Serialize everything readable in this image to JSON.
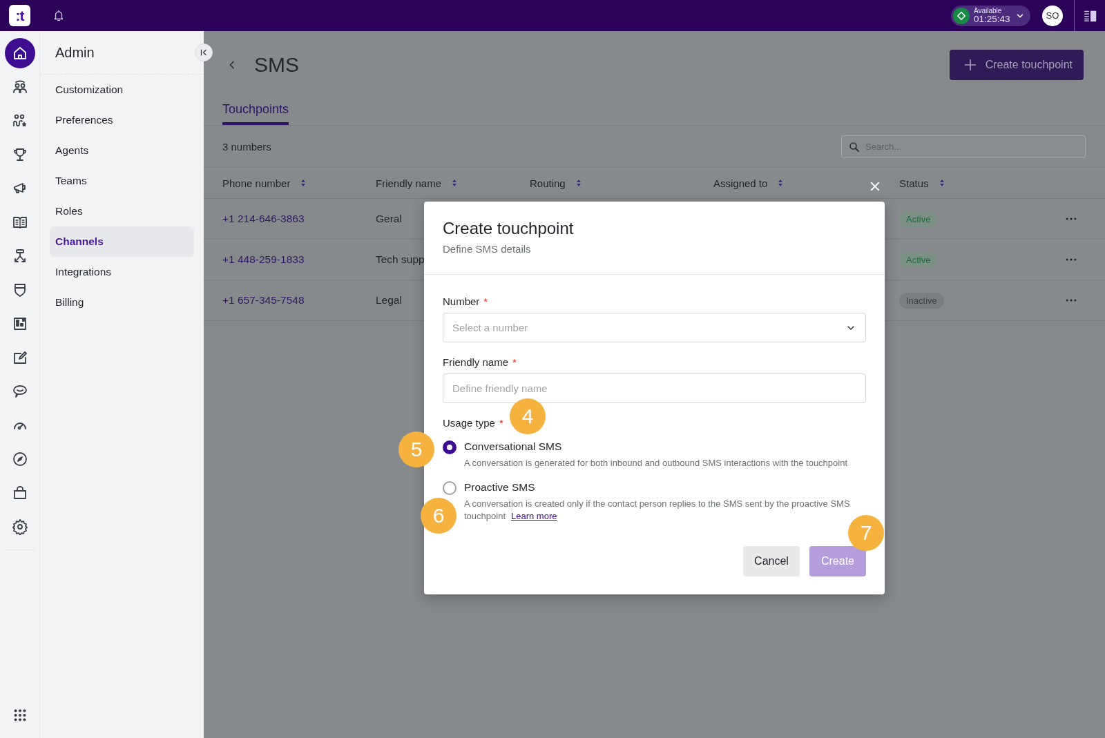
{
  "top_bar": {
    "logo": ":t",
    "status": "Available",
    "timer": "01:25:43",
    "avatar": "SO"
  },
  "rail": [
    {
      "kind": "home",
      "selected": true
    },
    {
      "kind": "people",
      "selected": false
    },
    {
      "kind": "people-star",
      "selected": false
    },
    {
      "kind": "trophy",
      "selected": false
    },
    {
      "kind": "megaphone",
      "selected": false
    },
    {
      "kind": "book",
      "selected": false
    },
    {
      "kind": "flow",
      "selected": false
    },
    {
      "kind": "shield",
      "selected": false
    },
    {
      "kind": "dashboard",
      "selected": false
    },
    {
      "kind": "edit",
      "selected": false
    },
    {
      "kind": "chat",
      "selected": false
    },
    {
      "kind": "gauge",
      "selected": false
    },
    {
      "kind": "compass",
      "selected": false
    },
    {
      "kind": "bag",
      "selected": false
    },
    {
      "kind": "gear",
      "selected": false
    }
  ],
  "admin": {
    "title": "Admin",
    "items": [
      {
        "label": "Customization",
        "selected": false
      },
      {
        "label": "Preferences",
        "selected": false
      },
      {
        "label": "Agents",
        "selected": false
      },
      {
        "label": "Teams",
        "selected": false
      },
      {
        "label": "Roles",
        "selected": false
      },
      {
        "label": "Channels",
        "selected": true
      },
      {
        "label": "Integrations",
        "selected": false
      },
      {
        "label": "Billing",
        "selected": false
      }
    ]
  },
  "page": {
    "title": "SMS",
    "create_button": "Create touchpoint",
    "tabs": [
      {
        "label": "Touchpoints",
        "selected": true
      }
    ],
    "count": "3 numbers",
    "search": {
      "placeholder": "Search..."
    },
    "table": {
      "columns": [
        "Phone number",
        "Friendly name",
        "Routing",
        "Assigned to",
        "Status"
      ],
      "rows": [
        {
          "phone": "+1 214-646-3863",
          "friendly_name": "Geral",
          "status": "Active",
          "active": true
        },
        {
          "phone": "+1 448-259-1833",
          "friendly_name": "Tech supp",
          "status": "Active",
          "active": true
        },
        {
          "phone": "+1 657-345-7548",
          "friendly_name": "Legal",
          "status": "Inactive",
          "active": false
        }
      ]
    }
  },
  "modal": {
    "title": "Create touchpoint",
    "subtitle": "Define SMS details",
    "fields": [
      {
        "kind": "select",
        "label": "Number",
        "required_mark": "*",
        "placeholder": "Select a number"
      },
      {
        "kind": "text",
        "label": "Friendly name",
        "required_mark": "*",
        "placeholder": "Define friendly name"
      }
    ],
    "usage_type": {
      "label": "Usage type",
      "required_mark": "*",
      "options": [
        {
          "label": "Conversational SMS",
          "description": "A conversation is generated for both inbound and outbound SMS interactions with the touchpoint",
          "selected": true
        },
        {
          "label": "Proactive SMS",
          "description": "A conversation is created only if the contact person replies to the SMS sent by the proactive SMS touchpoint",
          "link": "Learn more",
          "selected": false
        }
      ]
    },
    "buttons": [
      {
        "kind": "secondary",
        "label": "Cancel",
        "disabled": false
      },
      {
        "kind": "primary",
        "label": "Create",
        "disabled": true
      }
    ]
  },
  "annotations": [
    {
      "label": "4"
    },
    {
      "label": "5"
    },
    {
      "label": "6"
    },
    {
      "label": "7"
    }
  ]
}
